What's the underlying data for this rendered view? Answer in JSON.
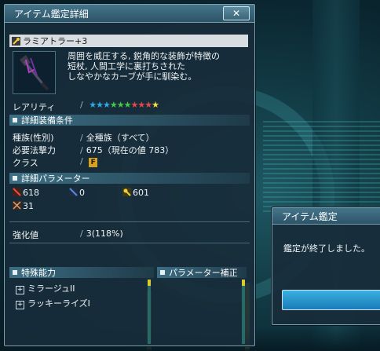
{
  "main_window": {
    "title": "アイテム鑑定詳細",
    "close_label": "✕",
    "item_name": "ラミアトラー+3",
    "description_lines": [
      "周囲を威圧する, 鋭角的な装飾が特徴の",
      "短杖, 人間工学に裏打ちされた",
      "しなやかなカーブが手に馴染む。"
    ],
    "rarity_label": "レアリティ",
    "rarity_stars": 10,
    "star_colors": [
      "#30a8e8",
      "#30a8e8",
      "#30a8e8",
      "#48c848",
      "#48c848",
      "#48c848",
      "#e84848",
      "#e84848",
      "#e84848",
      "#f0e040"
    ],
    "requirements_header": "詳細装備条件",
    "race_label": "種族(性別)",
    "race_value": "全種族（すべて）",
    "required_label": "必要法撃力",
    "required_value": "675（現在の値 783）",
    "class_label": "クラス",
    "class_badge": "F",
    "params_header": "詳細パラメーター",
    "params": [
      {
        "icon": "melee-attack-icon",
        "value": "618"
      },
      {
        "icon": "ranged-attack-icon",
        "value": "0"
      },
      {
        "icon": "tech-attack-icon",
        "value": "601"
      },
      {
        "icon": "dexterity-icon",
        "value": "31"
      }
    ],
    "enhance_label": "強化値",
    "enhance_value": "3(118%)",
    "special_header": "特殊能力",
    "special_items": [
      "ミラージュII",
      "ラッキーライズI"
    ],
    "param_bonus_header": "パラメーター補正"
  },
  "popup": {
    "title": "アイテム鑑定",
    "message": "鑑定が終了しました。"
  },
  "colors": {
    "panel": "#182c3a",
    "header": "#3d6f84",
    "accent_yellow": "#d8cc30"
  }
}
